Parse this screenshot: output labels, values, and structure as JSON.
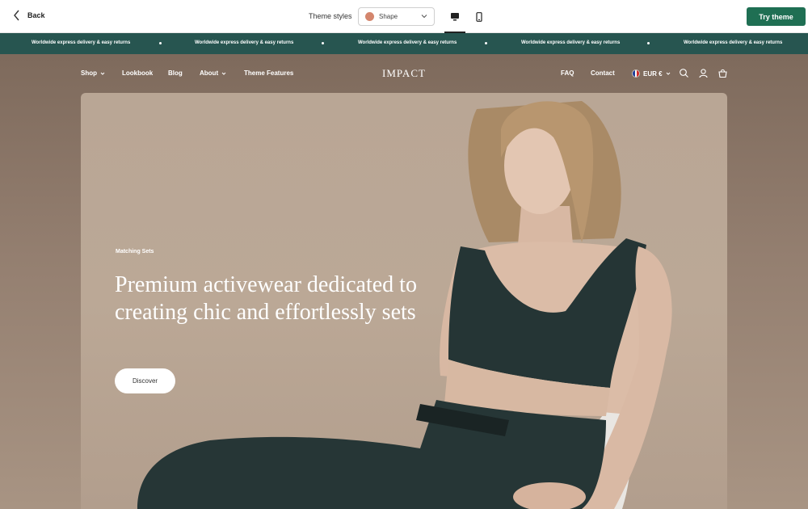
{
  "editor": {
    "back_label": "Back",
    "styles_label": "Theme styles",
    "style_value": "Shape",
    "swatch_color": "#d4866d",
    "try_label": "Try theme",
    "try_color": "#1f6f53"
  },
  "announcement": {
    "items": [
      "Worldwide express delivery & easy returns",
      "Worldwide express delivery & easy returns",
      "Worldwide express delivery & easy returns",
      "Worldwide express delivery & easy returns",
      "Worldwide express delivery & easy returns"
    ],
    "bg_color": "#275550"
  },
  "nav": {
    "shop": "Shop",
    "lookbook": "Lookbook",
    "blog": "Blog",
    "about": "About",
    "theme_features": "Theme Features",
    "logo": "IMPACT",
    "faq": "FAQ",
    "contact": "Contact",
    "currency": "EUR €"
  },
  "hero": {
    "eyebrow": "Matching Sets",
    "headline": "Premium activewear dedicated to creating chic and effortlessly sets",
    "button": "Discover"
  }
}
